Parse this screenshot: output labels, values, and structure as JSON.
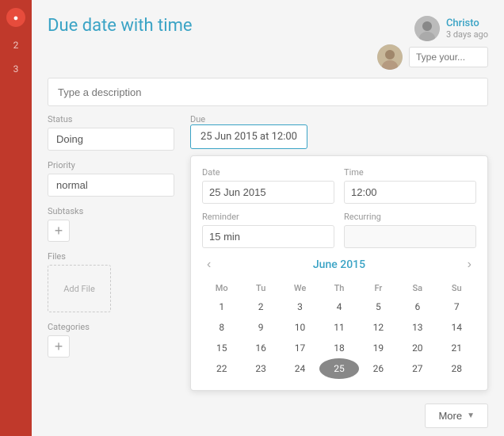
{
  "sidebar": {
    "badge1": "●",
    "num1": "2",
    "num2": "3"
  },
  "header": {
    "title": "Due date with time",
    "user": {
      "name": "Christo",
      "time": "3 days ago"
    },
    "comment_placeholder": "Type your..."
  },
  "description": {
    "placeholder": "Type a description"
  },
  "left": {
    "status_label": "Status",
    "status_value": "Doing",
    "priority_label": "Priority",
    "priority_value": "normal",
    "subtasks_label": "Subtasks",
    "subtasks_add": "+",
    "files_label": "Files",
    "files_add": "Add File",
    "categories_label": "Categories",
    "categories_add": "+"
  },
  "right": {
    "due_label": "Due",
    "due_value": "25 Jun 2015 at 12:00",
    "date_label": "Date",
    "date_value": "25 Jun 2015",
    "time_label": "Time",
    "time_value": "12:00",
    "reminder_label": "Reminder",
    "reminder_value": "15 min",
    "recurring_label": "Recurring",
    "recurring_value": "",
    "calendar": {
      "month": "June 2015",
      "headers": [
        "Mo",
        "Tu",
        "We",
        "Th",
        "Fr",
        "Sa",
        "Su"
      ],
      "weeks": [
        [
          1,
          2,
          3,
          4,
          5,
          6,
          7
        ],
        [
          8,
          9,
          10,
          11,
          12,
          13,
          14
        ],
        [
          15,
          16,
          17,
          18,
          19,
          20,
          21
        ],
        [
          22,
          23,
          24,
          25,
          26,
          27,
          28
        ]
      ],
      "selected": 25
    }
  },
  "footer": {
    "more_label": "More",
    "more_chevron": "▼"
  }
}
